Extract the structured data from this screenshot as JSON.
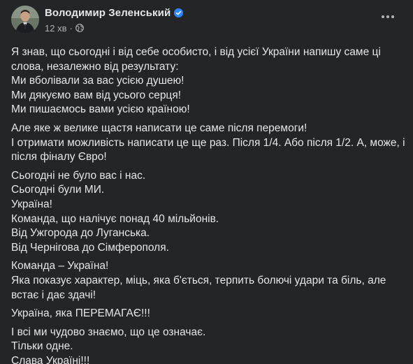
{
  "post": {
    "author": "Володимир Зеленський",
    "time": "12 хв",
    "separator": "·",
    "verified_icon": "verified-badge-icon",
    "privacy_icon": "globe-icon",
    "more_icon": "more-options-icon",
    "colors": {
      "background": "#242526",
      "text": "#e4e6eb",
      "secondary": "#b0b3b8",
      "verified": "#2d88ff"
    },
    "paragraphs": [
      {
        "lines": [
          "Я знав, що сьогодні і від себе особисто, і від усієї України напишу саме ці",
          "слова, незалежно від результату:",
          "Ми вболівали за вас усією душею!",
          "Ми дякуємо вам від усього серця!",
          "Ми пишаємось вами усією країною!"
        ]
      },
      {
        "lines": [
          "Але яке ж велике щастя написати це саме після перемоги!",
          "І отримати можливість написати це ще раз. Після 1/4. Або після 1/2. А, може, і",
          "після фіналу Євро!"
        ]
      },
      {
        "lines": [
          "Сьогодні не було вас і нас.",
          "Сьогодні були МИ.",
          "Україна!",
          "Команда, що налічує понад 40 мільйонів.",
          "Від Ужгорода до Луганська.",
          "Від Чернігова до Сімферополя."
        ]
      },
      {
        "lines": [
          "Команда – Україна!",
          "Яка показує характер, міць, яка б'ється, терпить болючі удари та біль, але",
          "встає і дає здачі!"
        ]
      },
      {
        "lines": [
          "Україна, яка ПЕРЕМАГАЄ!!!"
        ]
      },
      {
        "lines": [
          "І всі ми чудово знаємо, що це означає.",
          "Тільки одне.",
          "Слава Україні!!!"
        ]
      }
    ],
    "flags": [
      "ukraine-flag-emoji",
      "ukraine-flag-emoji",
      "ukraine-flag-emoji"
    ]
  }
}
